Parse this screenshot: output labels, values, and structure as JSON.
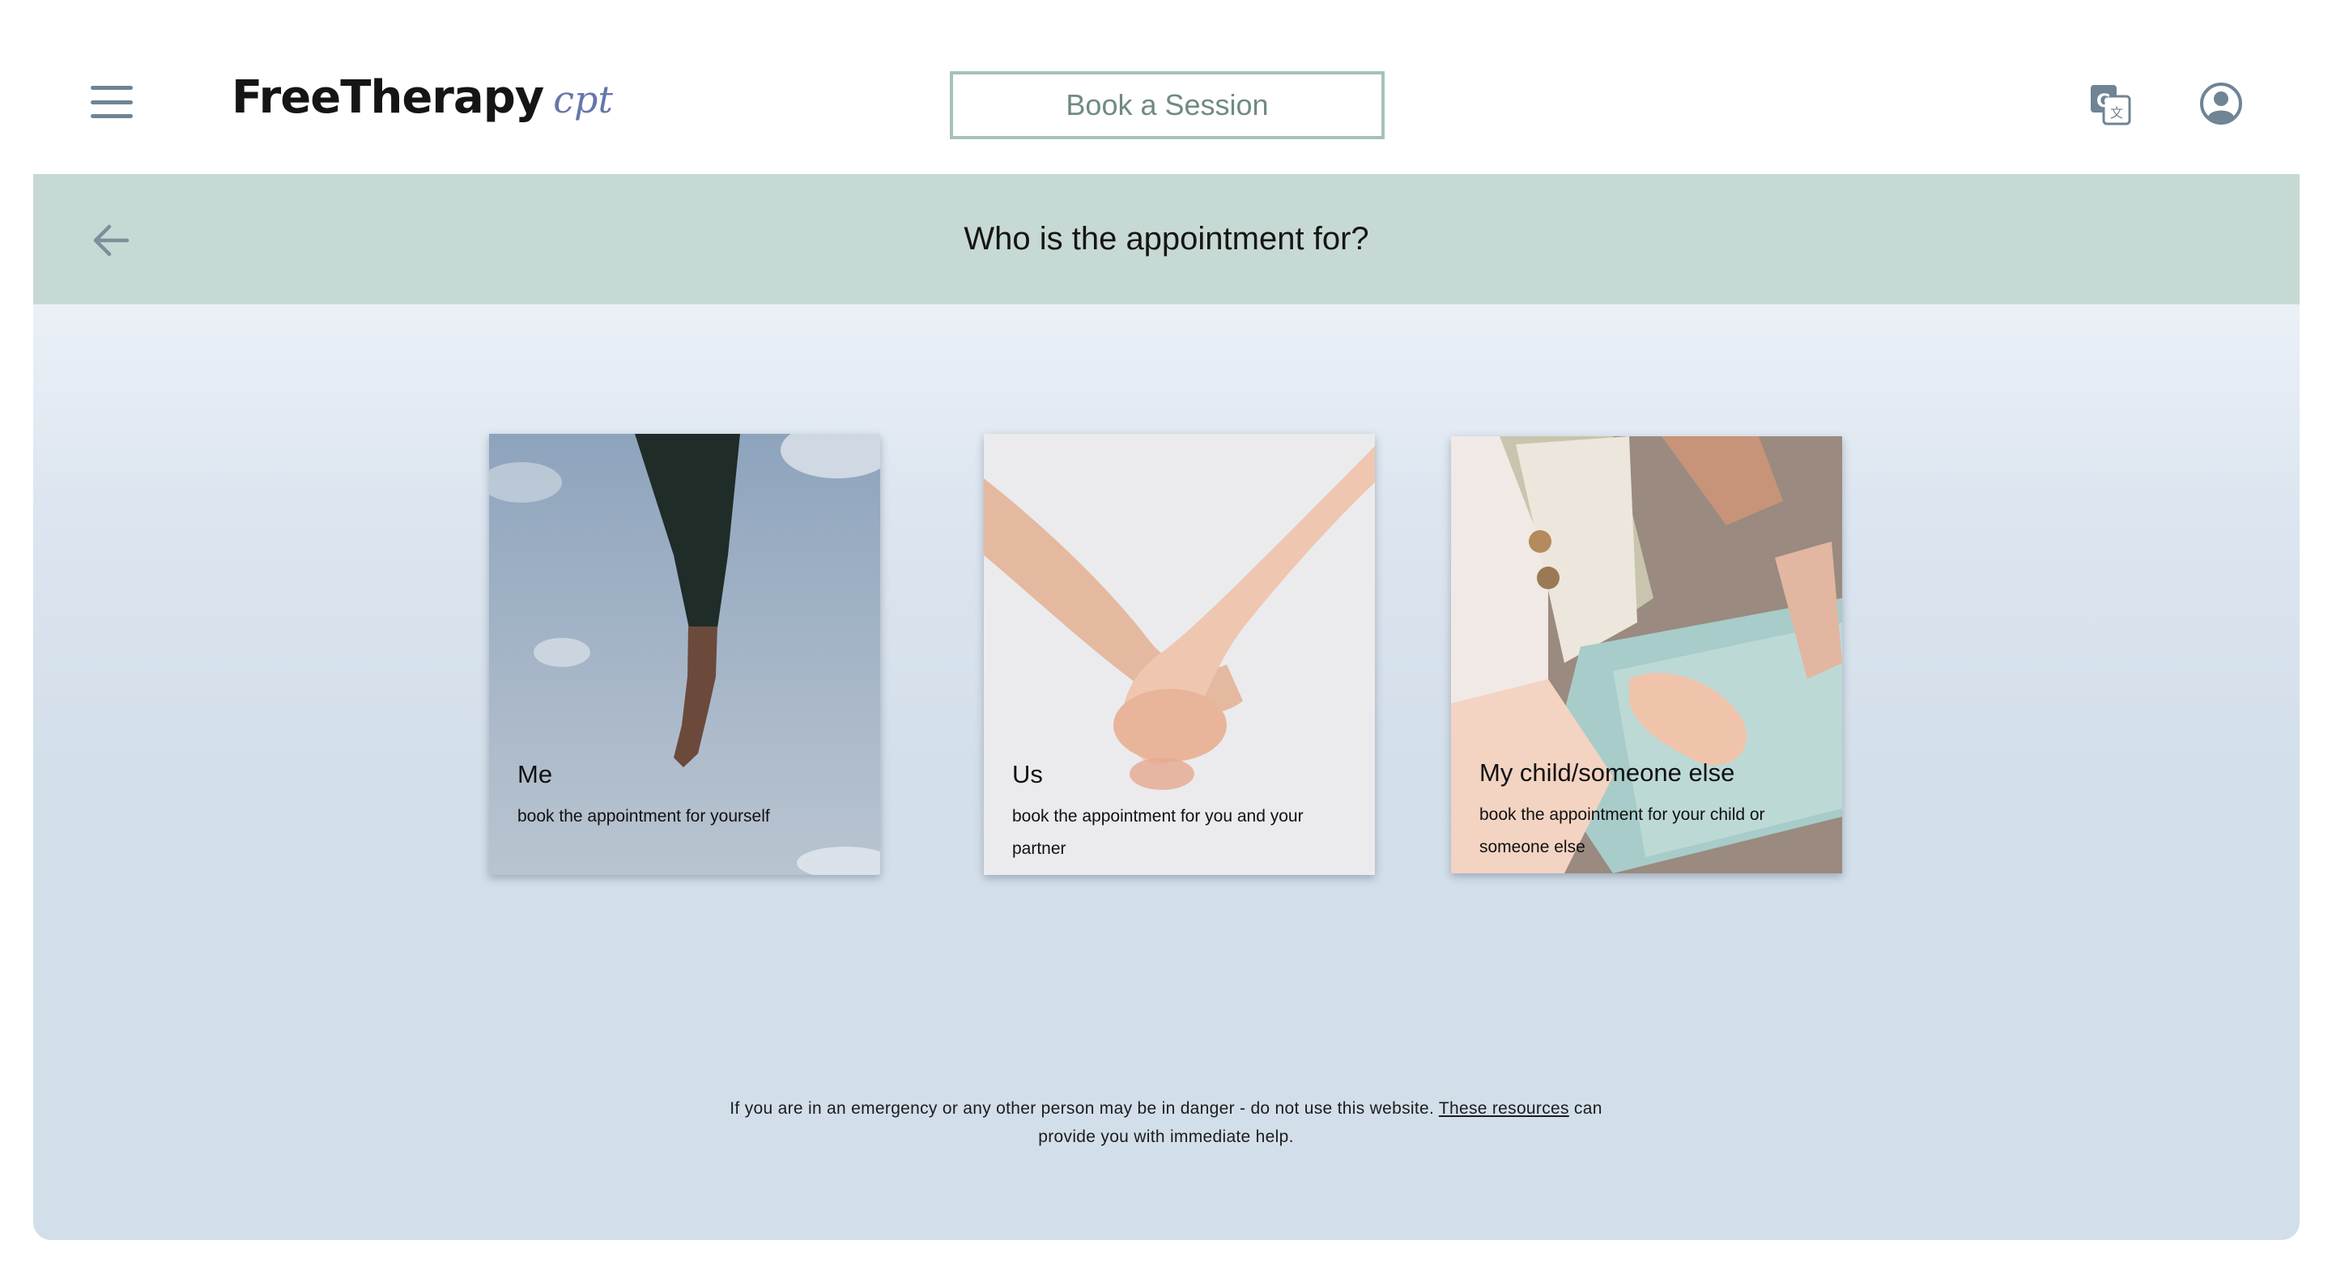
{
  "app": {
    "brand_main": "FreeTherapy",
    "brand_sub": "cpt"
  },
  "header": {
    "book_button_label": "Book a Session",
    "icons": {
      "menu": "hamburger-menu-icon",
      "translate": "google-translate-icon",
      "account": "user-account-icon"
    }
  },
  "page": {
    "title": "Who is the appointment for?",
    "back_icon": "arrow-left-icon"
  },
  "options": [
    {
      "title": "Me",
      "description": "book the appointment for yourself"
    },
    {
      "title": "Us",
      "description": "book the appointment for you and your partner"
    },
    {
      "title": "My child/someone else",
      "description": "book the appointment for your child or someone else"
    }
  ],
  "footer": {
    "notice_prefix": "If you are in an emergency or any other person may be in danger - do not use this website.",
    "link_text": "These resources",
    "notice_suffix": "can provide you with immediate help."
  },
  "colors": {
    "accent": "#6676a9",
    "header_band": "#c7d9d4",
    "book_border": "#a9c0ba",
    "icon": "#6f8494"
  }
}
